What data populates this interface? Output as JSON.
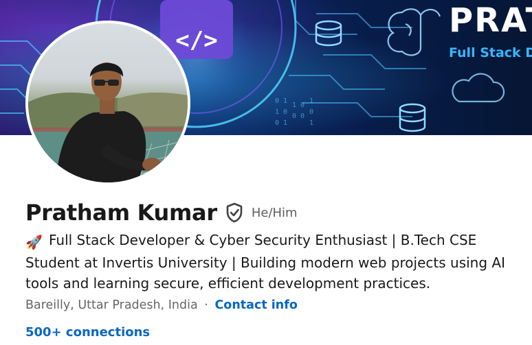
{
  "banner": {
    "brand_text": "PRAT",
    "tagline_text": "Full Stack Dev"
  },
  "profile": {
    "name": "Pratham Kumar",
    "pronouns": "He/Him",
    "headline_emoji": "🚀",
    "headline": "Full Stack Developer & Cyber Security Enthusiast | B.Tech CSE Student at Invertis University | Building modern web projects using AI tools and learning secure, efficient development practices.",
    "location": "Bareilly, Uttar Pradesh, India",
    "separator": "·",
    "contact_link": "Contact info",
    "connections": "500+ connections"
  },
  "icons": {
    "verified": "shield-check-icon",
    "headline_emoji": "rocket-icon"
  },
  "colors": {
    "link": "#0a66c2",
    "name": "#191919",
    "muted": "#666666",
    "banner_accent": "#38b6ff"
  }
}
